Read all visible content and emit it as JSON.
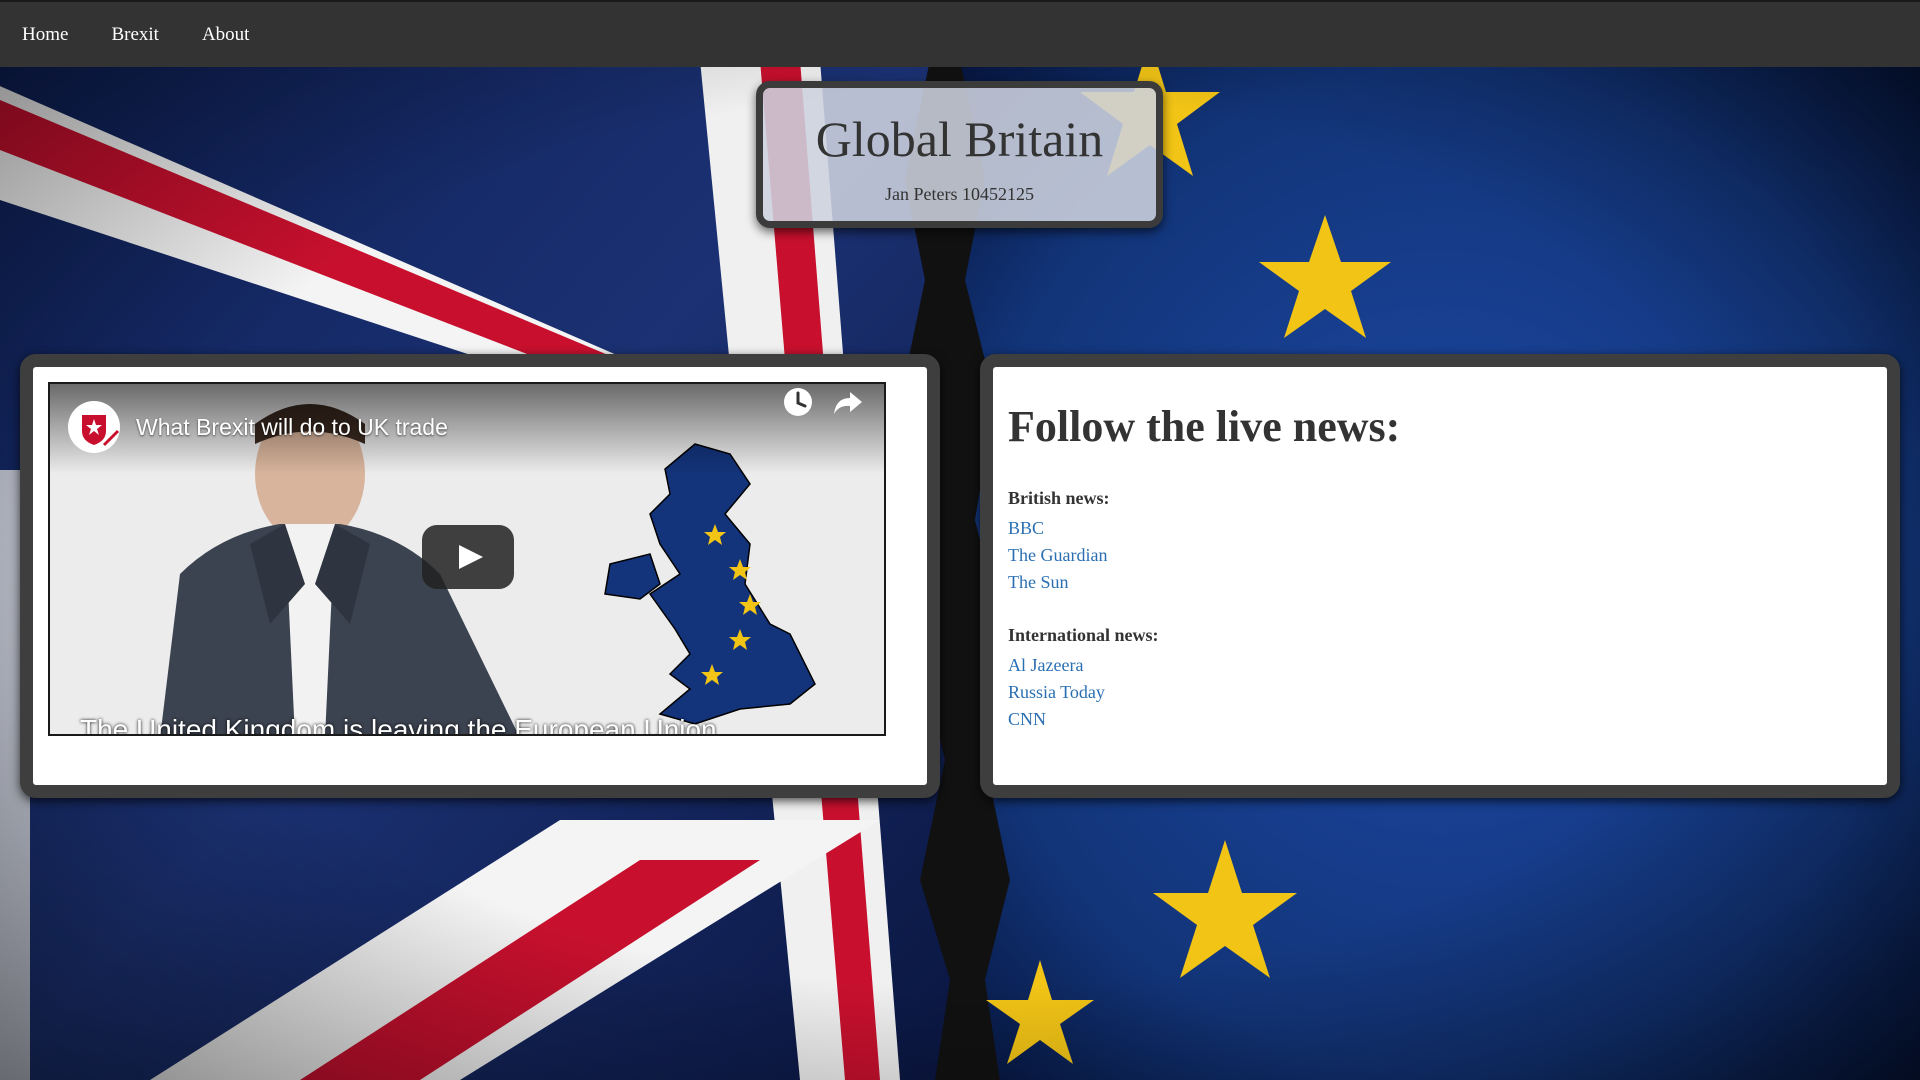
{
  "nav": {
    "items": [
      {
        "label": "Home"
      },
      {
        "label": "Brexit"
      },
      {
        "label": "About"
      }
    ]
  },
  "header": {
    "title": "Global Britain",
    "subtitle": "Jan Peters 10452125"
  },
  "video": {
    "title": "What Brexit will do to UK trade",
    "caption": "The United Kingdom is leaving the European Union",
    "icons": [
      "watch-later-icon",
      "share-icon",
      "play-icon"
    ]
  },
  "news": {
    "heading": "Follow the live news:",
    "groups": [
      {
        "title": "British news:",
        "links": [
          "BBC",
          "The Guardian",
          "The Sun"
        ]
      },
      {
        "title": "International news:",
        "links": [
          "Al Jazeera",
          "Russia Today",
          "CNN"
        ]
      }
    ]
  },
  "colors": {
    "nav_bg": "#333333",
    "panel_border": "#3e3e3e",
    "link": "#2a6fb2",
    "eu_blue": "#13337a",
    "eu_star": "#f2c416",
    "uk_red": "#c8102e"
  }
}
